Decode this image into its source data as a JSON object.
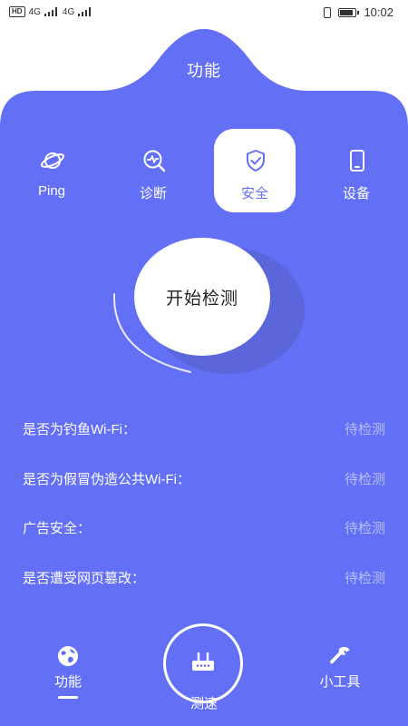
{
  "status_bar": {
    "left_tag": "HD",
    "net1": "4G",
    "net2": "4G",
    "time": "10:02"
  },
  "header": {
    "title": "功能"
  },
  "tabs": [
    {
      "label": "Ping",
      "icon": "planet-icon",
      "active": false
    },
    {
      "label": "诊断",
      "icon": "diagnose-icon",
      "active": false
    },
    {
      "label": "安全",
      "icon": "shield-check-icon",
      "active": true
    },
    {
      "label": "设备",
      "icon": "phone-icon",
      "active": false
    }
  ],
  "detect": {
    "label": "开始检测"
  },
  "checks": [
    {
      "question": "是否为钓鱼Wi-Fi：",
      "status": "待检测"
    },
    {
      "question": "是否为假冒伪造公共Wi-Fi：",
      "status": "待检测"
    },
    {
      "question": "广告安全：",
      "status": "待检测"
    },
    {
      "question": "是否遭受网页篡改：",
      "status": "待检测"
    }
  ],
  "bottom_nav": {
    "function_label": "功能",
    "speed_label": "测速",
    "tools_label": "小工具"
  },
  "colors": {
    "primary": "#6370f5",
    "pending_text": "#b9bff8"
  }
}
